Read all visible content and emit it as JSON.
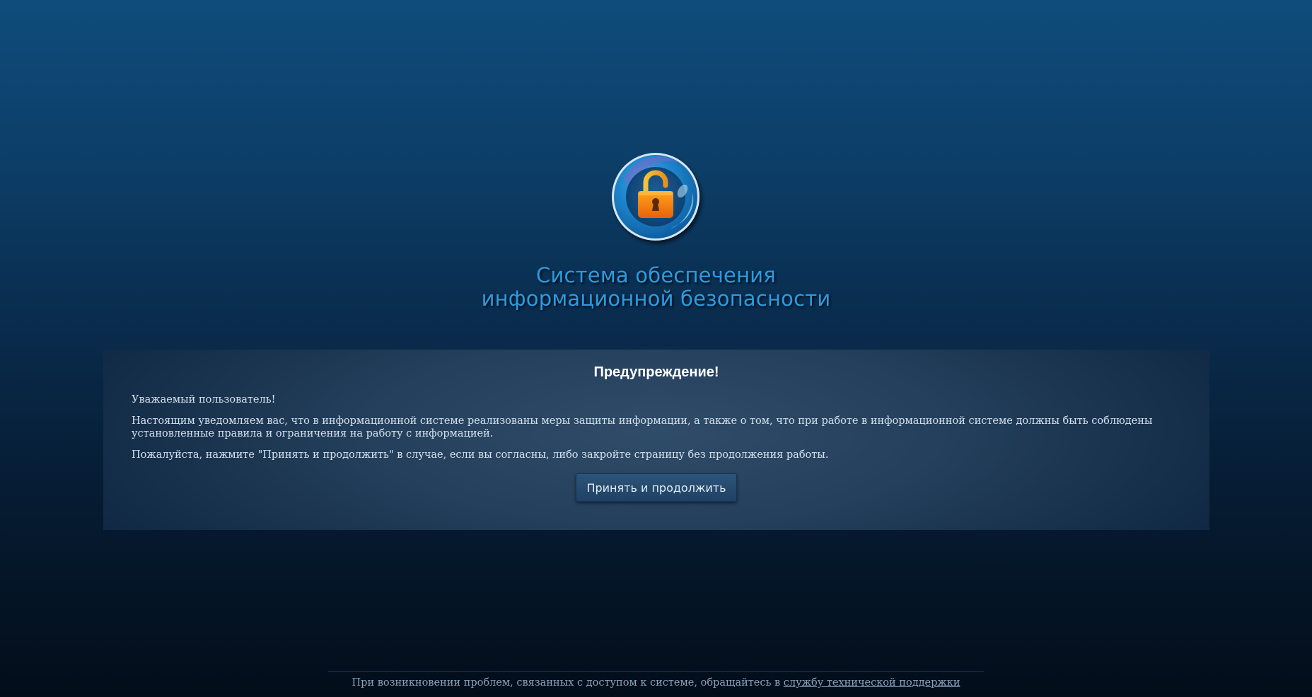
{
  "logo": {
    "icon": "unlocked-padlock-icon",
    "ring_color": "#1fa3dc",
    "lock_color": "#f58a0c"
  },
  "header": {
    "title_line1": "Система обеспечения",
    "title_line2": "информационной безопасности",
    "title_color": "#2d9be0"
  },
  "notice": {
    "heading": "Предупреждение!",
    "greeting": "Уважаемый пользователь!",
    "body": "Настоящим уведомляем вас, что в информационной системе реализованы меры защиты информации, а также о том, что при работе в информационной системе должны быть соблюдены установленные правила и ограничения на работу с информацией.",
    "instruction": "Пожалуйста, нажмите \"Принять и продолжить\" в случае, если вы согласны, либо закройте страницу без продолжения работы.",
    "accept_label": "Принять и продолжить"
  },
  "footer": {
    "text": "При возникновении проблем, связанных с доступом к системе, обращайтесь в ",
    "link_label": "службу технической поддержки"
  }
}
